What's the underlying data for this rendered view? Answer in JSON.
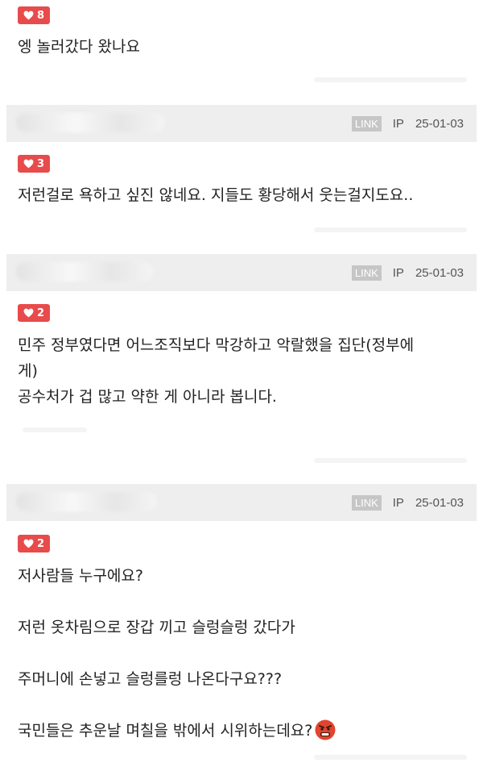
{
  "colors": {
    "like_badge": "#e84b4b",
    "header_bg": "#eeeeee",
    "link_badge": "#c6c6c6"
  },
  "comments": [
    {
      "likes": "8",
      "lines": [
        "엥 놀러갔다 왔나요"
      ]
    },
    {
      "header": {
        "link": "LINK",
        "ip": "IP",
        "date": "25-01-03"
      },
      "likes": "3",
      "lines": [
        "저런걸로 욕하고 싶진 않네요. 지들도 황당해서 웃는걸지도요.."
      ]
    },
    {
      "header": {
        "link": "LINK",
        "ip": "IP",
        "date": "25-01-03"
      },
      "likes": "2",
      "lines": [
        "민주 정부였다면 어느조직보다 막강하고 악랄했을 집단(정부에",
        "게)",
        "공수처가 겁 많고 약한 게 아니라 봅니다."
      ]
    },
    {
      "header": {
        "link": "LINK",
        "ip": "IP",
        "date": "25-01-03"
      },
      "likes": "2",
      "lines": [
        "저사람들 누구에요?",
        "저런 옷차림으로 장갑 끼고 슬렁슬렁 갔다가",
        "주머니에 손넣고 슬렁를렁 나온다구요???",
        "국민들은 추운날 며칠을 밖에서 시위하는데요?"
      ],
      "emoji": "angry-face-emoji"
    }
  ]
}
